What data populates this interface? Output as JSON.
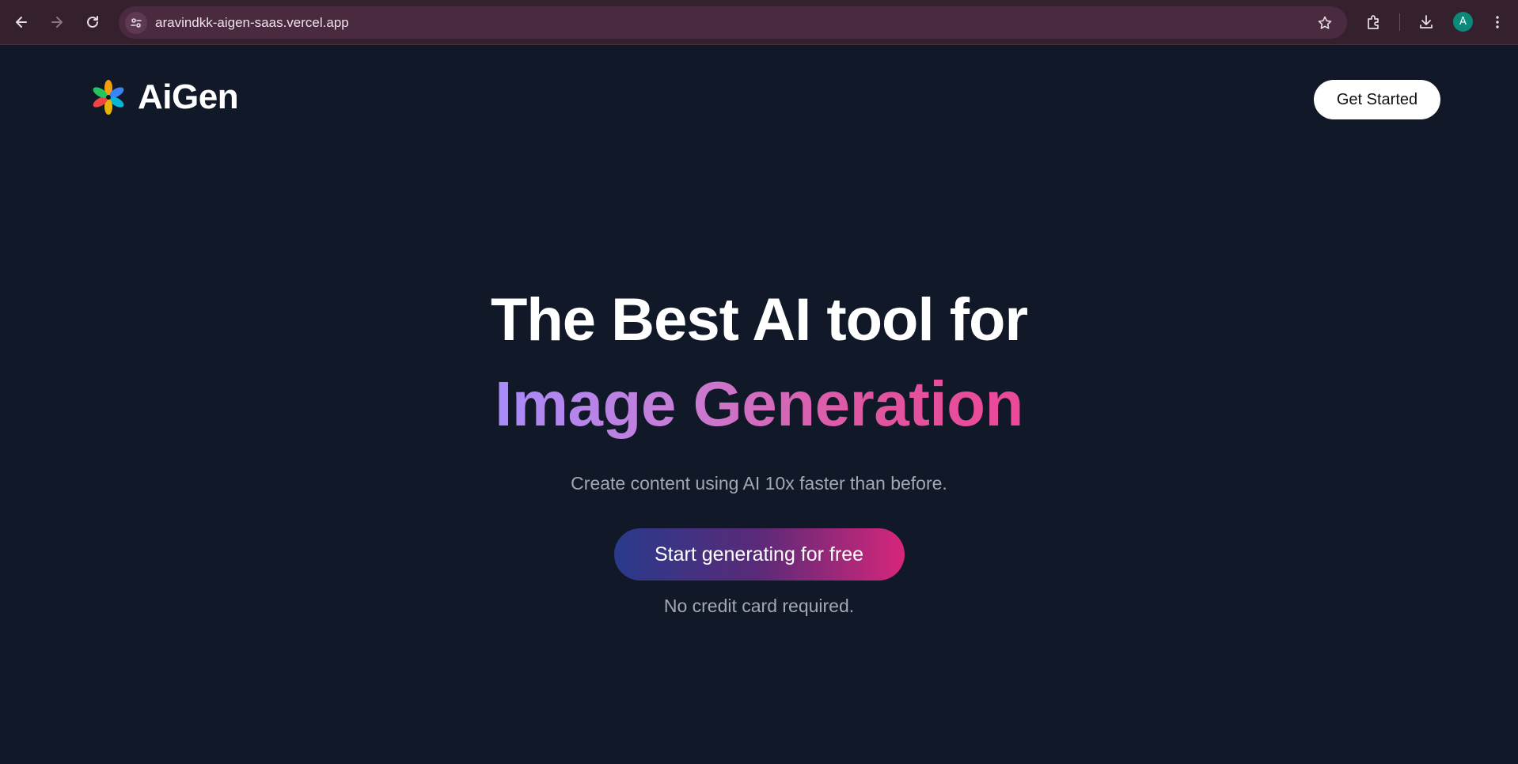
{
  "browser": {
    "url": "aravindkk-aigen-saas.vercel.app",
    "profile_initial": "A",
    "icons": {
      "back": "arrow-left-icon",
      "forward": "arrow-right-icon",
      "reload": "reload-icon",
      "site_info": "tune-icon",
      "bookmark": "star-icon",
      "extensions": "puzzle-icon",
      "downloads": "download-icon",
      "menu": "kebab-menu-icon"
    },
    "colors": {
      "frame": "#35202e",
      "omnibox": "#4a2a3f",
      "avatar": "#0b8a7a"
    }
  },
  "header": {
    "brand": "AiGen",
    "logo_icon": "pinwheel-logo-icon",
    "cta_label": "Get Started"
  },
  "hero": {
    "headline_line1": "The Best AI tool for",
    "headline_line2": "Image Generation",
    "subtitle": "Create content using AI 10x faster than before.",
    "cta_label": "Start generating for free",
    "note": "No credit card required.",
    "colors": {
      "background": "#111827",
      "gradient_text_start": "#a78bfa",
      "gradient_text_end": "#ec4899",
      "cta_gradient_start": "#2a3a8c",
      "cta_gradient_end": "#d7267a"
    }
  }
}
